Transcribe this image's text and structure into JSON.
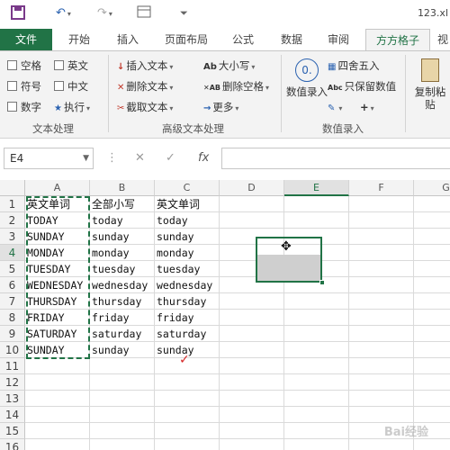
{
  "window": {
    "title": "123.xl"
  },
  "quick_access": {
    "save_icon": "save-icon",
    "undo_icon": "undo-icon",
    "redo_icon": "redo-icon"
  },
  "ribbon_tabs": [
    {
      "label": "文件"
    },
    {
      "label": "开始"
    },
    {
      "label": "插入"
    },
    {
      "label": "页面布局"
    },
    {
      "label": "公式"
    },
    {
      "label": "数据"
    },
    {
      "label": "审阅"
    },
    {
      "label": "方方格子"
    },
    {
      "label": "视"
    }
  ],
  "ribbon": {
    "text_processing": {
      "group_label": "文本处理",
      "checkboxes": [
        "空格",
        "英文",
        "符号",
        "中文",
        "数字"
      ],
      "execute_label": "执行"
    },
    "advanced_text": {
      "group_label": "高级文本处理",
      "buttons": [
        "插入文本",
        "删除文本",
        "截取文本",
        "大小写",
        "删除空格",
        "更多"
      ]
    },
    "numeric_entry": {
      "group_label": "数值录入",
      "value_entry": "数值录入",
      "round": "四舍五入",
      "keep_values": "只保留数值",
      "plus": "+"
    },
    "paste": {
      "label": "复制粘贴"
    }
  },
  "formula_bar": {
    "name_box": "E4",
    "fx_label": "fx",
    "formula": ""
  },
  "grid": {
    "columns": [
      "A",
      "B",
      "C",
      "D",
      "E",
      "F",
      "G"
    ],
    "selected_column": "E",
    "rows": [
      "1",
      "2",
      "3",
      "4",
      "5",
      "6",
      "7",
      "8",
      "9",
      "10",
      "11",
      "12",
      "13",
      "14",
      "15",
      "16"
    ],
    "selected_row": "4",
    "cells": [
      [
        "英文单词",
        "全部小写",
        "英文单词"
      ],
      [
        "TODAY",
        "today",
        "today"
      ],
      [
        "SUNDAY",
        "sunday",
        "sunday"
      ],
      [
        "MONDAY",
        "monday",
        "monday"
      ],
      [
        "TUESDAY",
        "tuesday",
        "tuesday"
      ],
      [
        "WEDNESDAY",
        "wednesday",
        "wednesday"
      ],
      [
        "THURSDAY",
        "thursday",
        "thursday"
      ],
      [
        "FRIDAY",
        "friday",
        "friday"
      ],
      [
        "SATURDAY",
        "saturday",
        "saturday"
      ],
      [
        "SUNDAY",
        "sunday",
        "sunday"
      ]
    ]
  },
  "watermark": "Bai经验"
}
